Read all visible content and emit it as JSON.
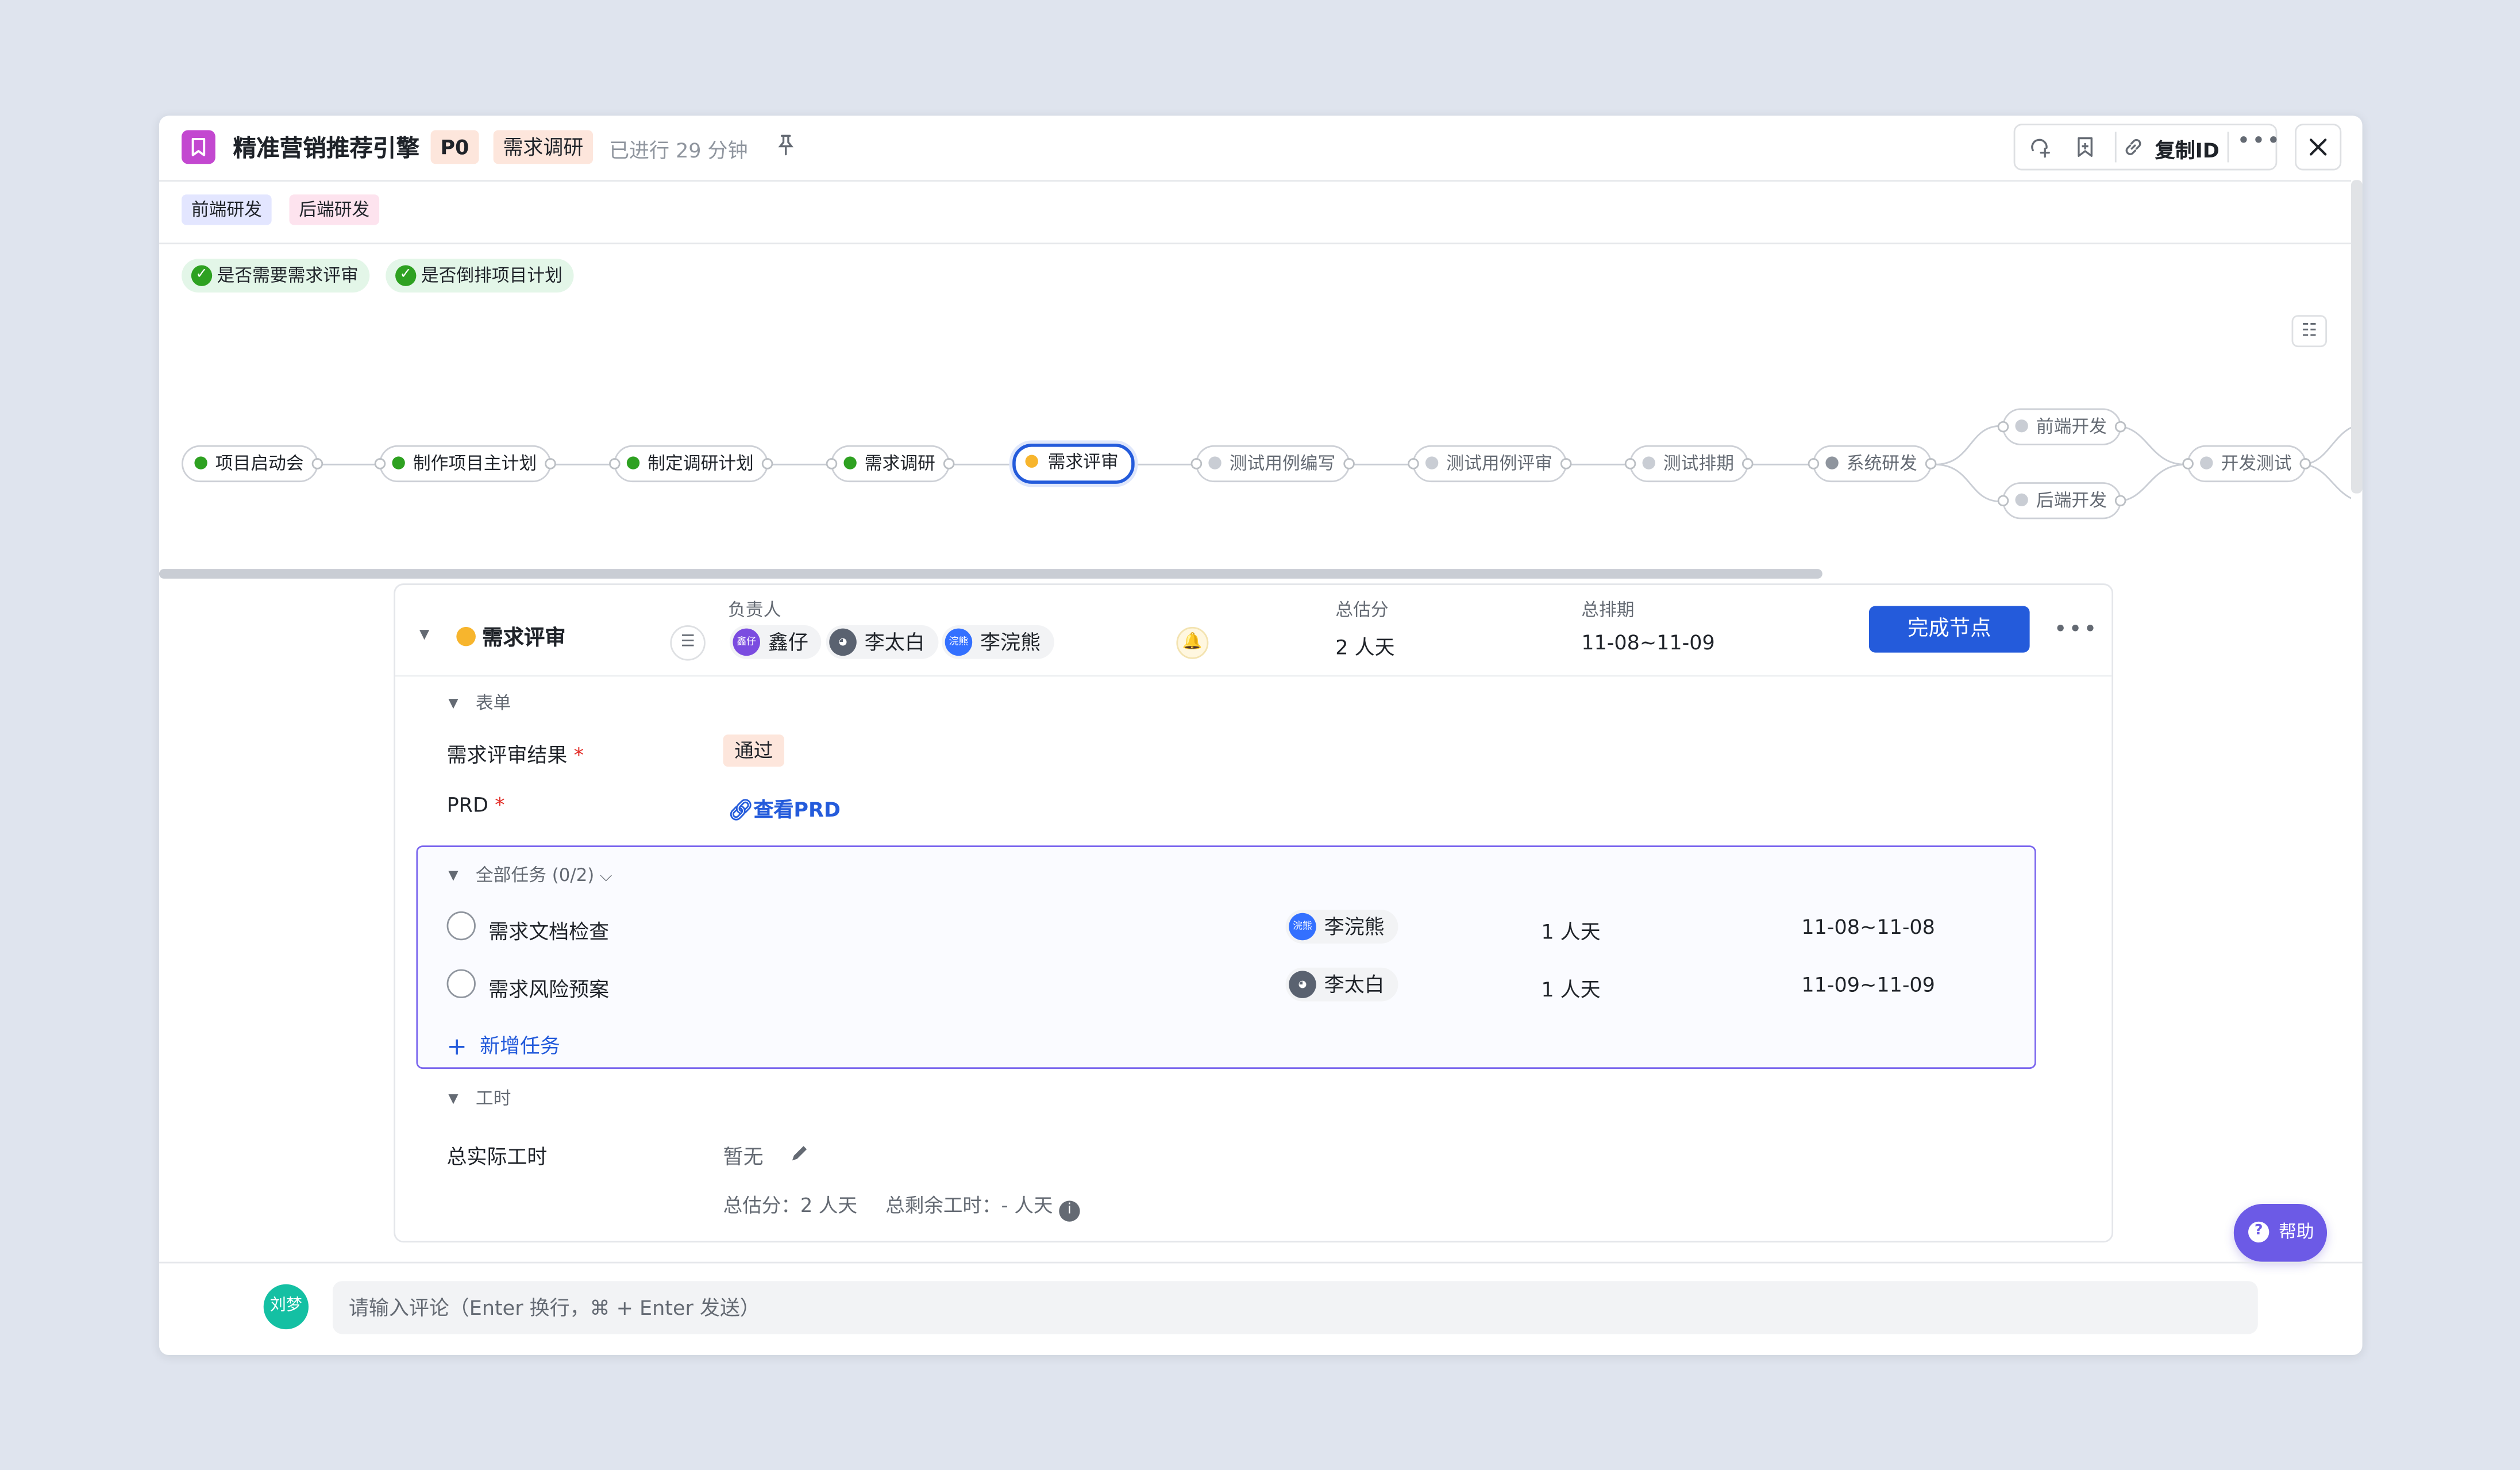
{
  "header": {
    "title": "精准营销推荐引擎",
    "priority": "P0",
    "stage": "需求调研",
    "elapsed": "已进行 29 分钟",
    "copy_id_label": "复制ID"
  },
  "labels": [
    "前端研发",
    "后端研发"
  ],
  "conditions": [
    "是否需要需求评审",
    "是否倒排项目计划"
  ],
  "flow": {
    "nodes": [
      {
        "label": "项目启动会",
        "status": "done"
      },
      {
        "label": "制作项目主计划",
        "status": "done"
      },
      {
        "label": "制定调研计划",
        "status": "done"
      },
      {
        "label": "需求调研",
        "status": "done"
      },
      {
        "label": "需求评审",
        "status": "current"
      },
      {
        "label": "测试用例编写",
        "status": "todo"
      },
      {
        "label": "测试用例评审",
        "status": "todo"
      },
      {
        "label": "测试排期",
        "status": "todo"
      },
      {
        "label": "系统研发",
        "status": "todo"
      },
      {
        "label": "前端开发",
        "status": "todo"
      },
      {
        "label": "后端开发",
        "status": "todo"
      },
      {
        "label": "开发测试",
        "status": "todo"
      }
    ]
  },
  "node_panel": {
    "title": "需求评审",
    "owner_label": "负责人",
    "owners": [
      {
        "name": "鑫仔",
        "avatar": "鑫仔",
        "color": "#7b4ce0"
      },
      {
        "name": "李太白",
        "avatar": "",
        "color": "#5a6270"
      },
      {
        "name": "李浣熊",
        "avatar": "浣熊",
        "color": "#3370ff"
      }
    ],
    "estimate_label": "总估分",
    "estimate_value": "2 人天",
    "schedule_label": "总排期",
    "schedule_value": "11-08~11-09",
    "complete_button": "完成节点",
    "form_label": "表单",
    "form_fields": [
      {
        "label": "需求评审结果",
        "value": "通过"
      },
      {
        "label": "PRD",
        "value": "查看PRD"
      }
    ],
    "tasks_header": "全部任务 (0/2)",
    "tasks": [
      {
        "name": "需求文档检查",
        "owner": "李浣熊",
        "owner_avatar": "浣熊",
        "owner_color": "#3370ff",
        "days": "1 人天",
        "date": "11-08~11-08"
      },
      {
        "name": "需求风险预案",
        "owner": "李太白",
        "owner_avatar": "",
        "owner_color": "#5a6270",
        "days": "1 人天",
        "date": "11-09~11-09"
      }
    ],
    "add_task_label": "新增任务",
    "worktime_label": "工时",
    "actual_label": "总实际工时",
    "actual_value": "暂无",
    "summary_estimate": "总估分：2 人天",
    "summary_remaining": "总剩余工时：- 人天"
  },
  "help_label": "帮助",
  "comment": {
    "avatar": "刘梦",
    "placeholder": "请输入评论（Enter 换行，⌘ + Enter 发送）"
  }
}
